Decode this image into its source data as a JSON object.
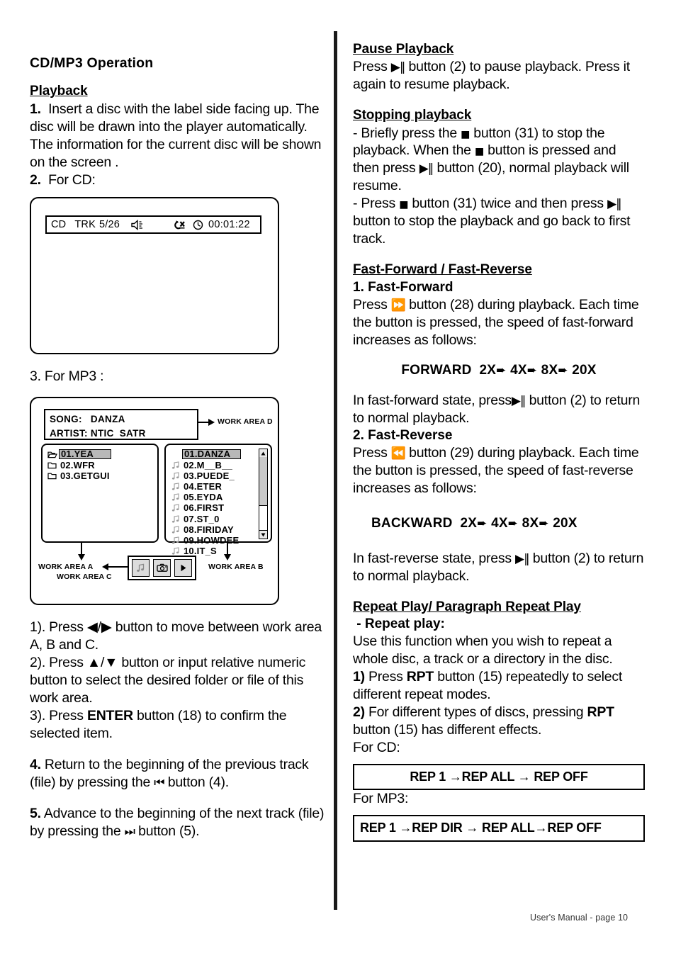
{
  "document": {
    "footer": "User's Manual - page 10"
  },
  "left_column": {
    "title": "CD/MP3  Operation",
    "playback_heading": "Playback",
    "step1_num": "1.",
    "step1_text": "Insert a disc with the label side facing up. The disc will be drawn into the player automatically. The information for the current disc will be shown on the screen .",
    "step2_num": "2.",
    "step2_text": "For CD:",
    "cd_display": {
      "source_label": "CD",
      "track_label": "TRK",
      "track_number": "5/26",
      "volume_icon": "speaker-icon",
      "repeat_off_icon": "repeat-off-icon",
      "clock_icon": "clock-icon",
      "elapsed_time": "00:01:22"
    },
    "step3_text": "3. For MP3 :",
    "mp3_display": {
      "song_label": "SONG:",
      "song_value": "DANZA",
      "artist_label": "ARTIST:",
      "artist_value": "NTIC  SATR",
      "work_area_d": "WORK AREA D",
      "work_area_a": "WORK AREA A",
      "work_area_b": "WORK AREA B",
      "work_area_c": "WORK AREA C",
      "folders": [
        {
          "name": "01.YEA",
          "icon": "folder-open-icon",
          "selected": true
        },
        {
          "name": "02.WFR",
          "icon": "folder-icon",
          "selected": false
        },
        {
          "name": "03.GETGUI",
          "icon": "folder-icon",
          "selected": false
        }
      ],
      "files": [
        {
          "name": "01.DANZA",
          "icon": "music-note-icon",
          "selected": true
        },
        {
          "name": "02.M__B__",
          "icon": "music-note-icon",
          "selected": false
        },
        {
          "name": "03.PUEDE_",
          "icon": "music-note-icon",
          "selected": false
        },
        {
          "name": "04.ETER",
          "icon": "music-note-icon",
          "selected": false
        },
        {
          "name": "05.EYDA",
          "icon": "music-note-icon",
          "selected": false
        },
        {
          "name": "06.FIRST",
          "icon": "music-note-icon",
          "selected": false
        },
        {
          "name": "07.ST_0",
          "icon": "music-note-icon",
          "selected": false
        },
        {
          "name": "08.FIRIDAY",
          "icon": "music-note-icon",
          "selected": false
        },
        {
          "name": "09.HOWDEE",
          "icon": "music-note-icon",
          "selected": false
        },
        {
          "name": "10.IT_S",
          "icon": "music-note-icon",
          "selected": false
        }
      ],
      "toolbar_buttons": [
        {
          "icon": "music-note-icon",
          "name": "audio-mode-button"
        },
        {
          "icon": "photo-camera-icon",
          "name": "photo-mode-button"
        },
        {
          "icon": "play-triangle-icon",
          "name": "play-button"
        }
      ]
    },
    "substep1": "1).  Press ◀/▶  button to move between work area  A, B and  C.",
    "substep2": "2).  Press ▲/▼ button or input relative numeric button to select the desired folder or file of this work area.",
    "substep3_a": "3).  Press ",
    "substep3_bold": "ENTER",
    "substep3_b": " button (18) to confirm the selected item.",
    "step4_num": "4.",
    "step4_a": " Return to the beginning of the previous track (file) by pressing the ",
    "step4_icon": "⏮",
    "step4_b": " button (4).",
    "step5_num": "5.",
    "step5_a": " Advance to the beginning of the next track (file) by pressing the ",
    "step5_icon": "⏭",
    "step5_b": " button (5)."
  },
  "right_column": {
    "pause": {
      "heading": "Pause Playback",
      "line_a": "Press ",
      "icon": "▶‖",
      "line_b": " button (2) to pause playback. Press it again to resume playback."
    },
    "stopping": {
      "heading": "Stopping playback",
      "b1_a": "- Briefly press the ",
      "b1_stop": "■",
      "b1_b": " button (31) to stop the playback.  When the ",
      "b1_stop2": "■",
      "b1_c": " button is pressed and then press ",
      "b1_play": "▶‖",
      "b1_d": " button (20), normal playback will resume.",
      "b2_a": "- Press ",
      "b2_stop": "■",
      "b2_b": " button (31) twice and then press ",
      "b2_play": "▶‖",
      "b2_c": " button to stop the playback and go back to first track."
    },
    "fast": {
      "heading": "Fast-Forward / Fast-Reverse",
      "ff_heading": "1. Fast-Forward",
      "ff_a": "Press ",
      "ff_icon": "⏩",
      "ff_b": " button (28) during playback. Each time the button is pressed, the speed of fast-forward increases as follows:",
      "forward_label": "FORWARD",
      "forward_steps": [
        "2X",
        "4X",
        "8X",
        "20X"
      ],
      "ff_return_a": "In fast-forward state, press",
      "ff_return_icon": "▶‖",
      "ff_return_b": " button (2) to return to normal playback.",
      "fr_heading": "2. Fast-Reverse",
      "fr_a": "Press ",
      "fr_icon": "⏪",
      "fr_b": " button (29) during playback. Each time the button is pressed, the speed of fast-reverse increases as follows:",
      "backward_label": "BACKWARD",
      "backward_steps": [
        "2X",
        "4X",
        "8X",
        "20X"
      ],
      "fr_return_a": "In fast-reverse state, press ",
      "fr_return_icon": "▶‖",
      "fr_return_b": " button (2) to return to normal playback."
    },
    "repeat": {
      "heading": "Repeat Play/ Paragraph Repeat Play",
      "subheading": "- Repeat play:",
      "intro": "Use this function when you wish to repeat a whole disc, a track or a directory in the disc.",
      "item1_num": "1)",
      "item1_a": "  Press ",
      "item1_bold": "RPT",
      "item1_b": " button (15) repeatedly to select different repeat modes.",
      "item2_num": "2)",
      "item2_a": "  For different types of discs, pressing ",
      "item2_bold": "RPT",
      "item2_b": " button (15) has different effects.",
      "for_cd": "For CD:",
      "cd_modes": "REP 1 →REP  ALL → REP OFF",
      "for_mp3": "For MP3:",
      "mp3_modes": "REP 1 →REP  DIR → REP ALL→REP OFF"
    }
  }
}
